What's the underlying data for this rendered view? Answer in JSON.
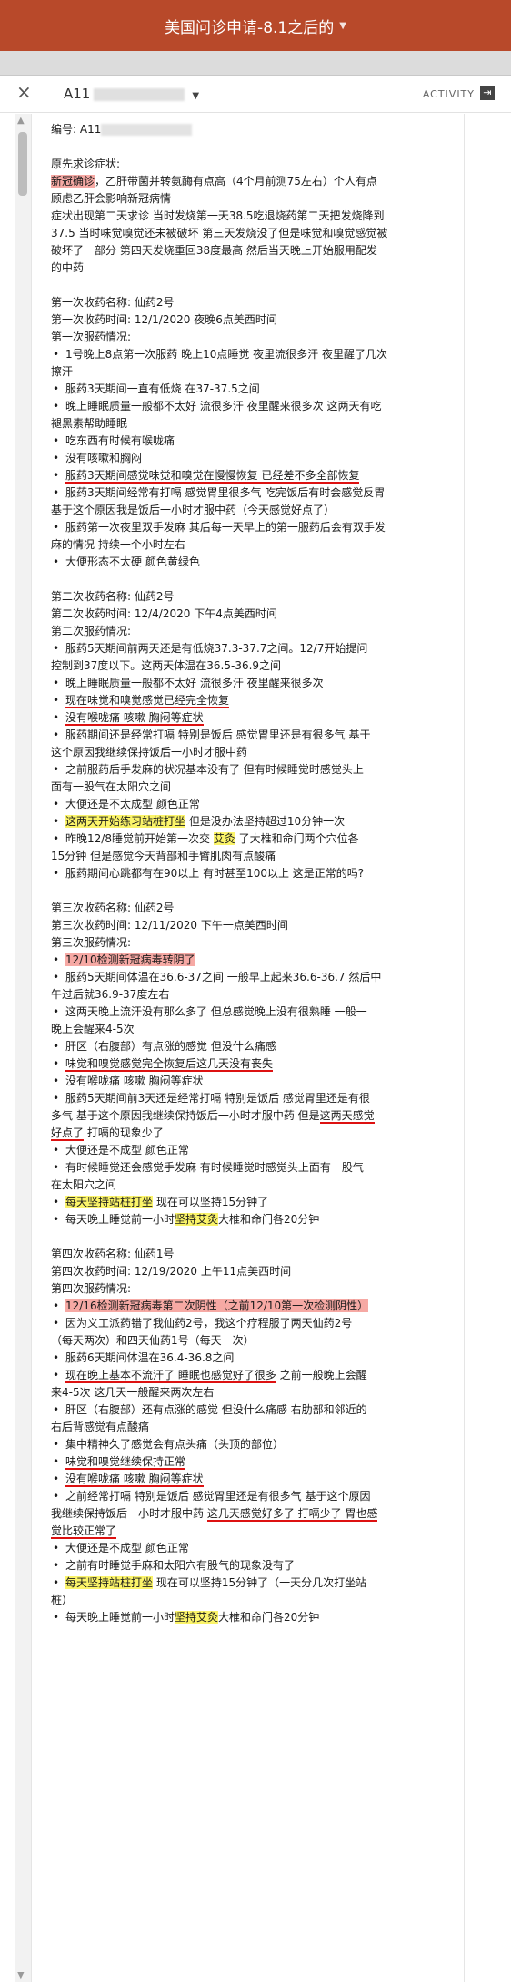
{
  "topbar": {
    "title": "美国问诊申请-8.1之后的"
  },
  "header": {
    "title": "A11",
    "activity": "ACTIVITY"
  },
  "content": {
    "id_label": "编号: A11",
    "sections": [
      {
        "lines": [
          {
            "t": "原先求诊症状:"
          },
          {
            "parts": [
              {
                "t": "新冠确诊",
                "h": "red"
              },
              {
                "t": "，乙肝带菌并转氨酶有点高（4个月前测75左右）个人有点"
              }
            ]
          },
          {
            "t": "顾虑乙肝会影响新冠病情"
          },
          {
            "t": "症状出现第二天求诊 当时发烧第一天38.5吃退烧药第二天把发烧降到"
          },
          {
            "t": "37.5 当时味觉嗅觉还未被破坏 第三天发烧没了但是味觉和嗅觉感觉被"
          },
          {
            "t": "破坏了一部分 第四天发烧重回38度最高 然后当天晚上开始服用配发"
          },
          {
            "t": "的中药"
          }
        ]
      },
      {
        "lines": [
          {
            "t": "第一次收药名称: 仙药2号"
          },
          {
            "t": "第一次收药时间: 12/1/2020 夜晚6点美西时间"
          },
          {
            "t": "第一次服药情况:"
          },
          {
            "b": 1,
            "t": "1号晚上8点第一次服药 晚上10点睡觉 夜里流很多汗 夜里醒了几次"
          },
          {
            "t": "擦汗"
          },
          {
            "b": 1,
            "t": "服药3天期间一直有低烧 在37-37.5之间"
          },
          {
            "b": 1,
            "t": "晚上睡眠质量一般都不太好 流很多汗 夜里醒来很多次 这两天有吃"
          },
          {
            "t": "褪黑素帮助睡眠"
          },
          {
            "b": 1,
            "t": "吃东西有时候有喉咙痛"
          },
          {
            "b": 1,
            "t": "没有咳嗽和胸闷"
          },
          {
            "b": 1,
            "parts": [
              {
                "t": "服药3天期间感觉味觉和嗅觉在慢慢恢复 已经差不多全部恢复",
                "h": "ul"
              }
            ]
          },
          {
            "b": 1,
            "t": "服药3天期间经常有打嗝 感觉胃里很多气 吃完饭后有时会感觉反胃"
          },
          {
            "t": "基于这个原因我是饭后一小时才服中药（今天感觉好点了）"
          },
          {
            "b": 1,
            "t": "服药第一次夜里双手发麻 其后每一天早上的第一服药后会有双手发"
          },
          {
            "t": "麻的情况 持续一个小时左右"
          },
          {
            "b": 1,
            "t": "大便形态不太硬 颜色黄绿色"
          }
        ]
      },
      {
        "lines": [
          {
            "t": "第二次收药名称: 仙药2号"
          },
          {
            "t": "第二次收药时间: 12/4/2020 下午4点美西时间"
          },
          {
            "t": "第二次服药情况:"
          },
          {
            "b": 1,
            "t": "服药5天期间前两天还是有低烧37.3-37.7之间。12/7开始提问"
          },
          {
            "t": "控制到37度以下。这两天体温在36.5-36.9之间"
          },
          {
            "b": 1,
            "t": "晚上睡眠质量一般都不太好 流很多汗 夜里醒来很多次"
          },
          {
            "b": 1,
            "parts": [
              {
                "t": "现在味觉和嗅觉感觉已经完全恢复",
                "h": "ul"
              }
            ]
          },
          {
            "b": 1,
            "parts": [
              {
                "t": "没有喉咙痛 咳嗽 胸闷等症状",
                "h": "ul"
              }
            ]
          },
          {
            "b": 1,
            "t": "服药期间还是经常打嗝 特别是饭后 感觉胃里还是有很多气 基于"
          },
          {
            "t": "这个原因我继续保持饭后一小时才服中药"
          },
          {
            "b": 1,
            "t": "之前服药后手发麻的状况基本没有了 但有时候睡觉时感觉头上"
          },
          {
            "t": "面有一股气在太阳穴之间"
          },
          {
            "b": 1,
            "t": "大便还是不太成型 颜色正常"
          },
          {
            "b": 1,
            "parts": [
              {
                "t": "这两天开始练习站桩打坐",
                "h": "yel"
              },
              {
                "t": " 但是没办法坚持超过10分钟一次"
              }
            ]
          },
          {
            "b": 1,
            "parts": [
              {
                "t": "昨晚12/8睡觉前开始第一次交 "
              },
              {
                "t": "艾灸",
                "h": "yel"
              },
              {
                "t": " 了大椎和命门两个穴位各"
              }
            ]
          },
          {
            "t": "15分钟 但是感觉今天背部和手臂肌肉有点酸痛"
          },
          {
            "b": 1,
            "t": "服药期间心跳都有在90以上 有时甚至100以上 这是正常的吗?"
          }
        ]
      },
      {
        "lines": [
          {
            "t": "第三次收药名称: 仙药2号"
          },
          {
            "t": "第三次收药时间: 12/11/2020 下午一点美西时间"
          },
          {
            "t": "第三次服药情况:"
          },
          {
            "b": 1,
            "parts": [
              {
                "t": "12/10检测新冠病毒转阴了",
                "h": "red"
              }
            ]
          },
          {
            "b": 1,
            "t": "服药5天期间体温在36.6-37之间 一般早上起来36.6-36.7 然后中"
          },
          {
            "t": "午过后就36.9-37度左右"
          },
          {
            "b": 1,
            "t": "这两天晚上流汗没有那么多了 但总感觉晚上没有很熟睡 一般一"
          },
          {
            "t": "晚上会醒来4-5次"
          },
          {
            "b": 1,
            "t": "肝区（右腹部）有点涨的感觉 但没什么痛感"
          },
          {
            "b": 1,
            "parts": [
              {
                "t": "味觉和嗅觉感觉完全恢复后这几天没有丧失",
                "h": "ul"
              }
            ]
          },
          {
            "b": 1,
            "t": "没有喉咙痛 咳嗽 胸闷等症状"
          },
          {
            "b": 1,
            "t": "服药5天期间前3天还是经常打嗝 特别是饭后 感觉胃里还是有很"
          },
          {
            "parts": [
              {
                "t": "多气 基于这个原因我继续保持饭后一小时才服中药 但是"
              },
              {
                "t": "这两天感觉",
                "h": "ul"
              }
            ]
          },
          {
            "parts": [
              {
                "t": "好点了",
                "h": "ul"
              },
              {
                "t": " 打嗝的现象少了"
              }
            ]
          },
          {
            "b": 1,
            "t": "大便还是不成型 颜色正常"
          },
          {
            "b": 1,
            "t": "有时候睡觉还会感觉手发麻 有时候睡觉时感觉头上面有一股气"
          },
          {
            "t": "在太阳穴之间"
          },
          {
            "b": 1,
            "parts": [
              {
                "t": "每天坚持站桩打坐",
                "h": "yel"
              },
              {
                "t": " 现在可以坚持15分钟了"
              }
            ]
          },
          {
            "b": 1,
            "parts": [
              {
                "t": "每天晚上睡觉前一小时"
              },
              {
                "t": "坚持艾灸",
                "h": "yel"
              },
              {
                "t": "大椎和命门各20分钟"
              }
            ]
          }
        ]
      },
      {
        "lines": [
          {
            "t": "第四次收药名称: 仙药1号"
          },
          {
            "t": "第四次收药时间: 12/19/2020 上午11点美西时间"
          },
          {
            "t": "第四次服药情况:"
          },
          {
            "b": 1,
            "parts": [
              {
                "t": "12/16检测新冠病毒第二次阴性（之前12/10第一次检测阴性）",
                "h": "red"
              }
            ]
          },
          {
            "b": 1,
            "t": "因为义工派药错了我仙药2号，我这个疗程服了两天仙药2号"
          },
          {
            "t": "（每天两次）和四天仙药1号（每天一次）"
          },
          {
            "b": 1,
            "t": "服药6天期间体温在36.4-36.8之间"
          },
          {
            "b": 1,
            "parts": [
              {
                "t": "现在晚上基本不流汗了 睡眠也感觉好了很多",
                "h": "ul"
              },
              {
                "t": " 之前一般晚上会醒"
              }
            ]
          },
          {
            "t": "来4-5次 这几天一般醒来两次左右"
          },
          {
            "b": 1,
            "t": "肝区（右腹部）还有点涨的感觉 但没什么痛感 右肋部和邻近的"
          },
          {
            "t": "右后背感觉有点酸痛"
          },
          {
            "b": 1,
            "t": "集中精神久了感觉会有点头痛（头顶的部位）"
          },
          {
            "b": 1,
            "parts": [
              {
                "t": "味觉和嗅觉继续保持正常",
                "h": "ul"
              }
            ]
          },
          {
            "b": 1,
            "parts": [
              {
                "t": "没有喉咙痛 咳嗽 胸闷等症状",
                "h": "ul"
              }
            ]
          },
          {
            "b": 1,
            "t": "之前经常打嗝 特别是饭后 感觉胃里还是有很多气 基于这个原因"
          },
          {
            "parts": [
              {
                "t": "我继续保持饭后一小时才服中药 "
              },
              {
                "t": "这几天感觉好多了 打嗝少了 胃也感",
                "h": "ul"
              }
            ]
          },
          {
            "parts": [
              {
                "t": "觉比较正常了",
                "h": "ul"
              }
            ]
          },
          {
            "b": 1,
            "t": "大便还是不成型 颜色正常"
          },
          {
            "b": 1,
            "t": "之前有时睡觉手麻和太阳穴有股气的现象没有了"
          },
          {
            "b": 1,
            "parts": [
              {
                "t": "每天坚持站桩打坐",
                "h": "yel"
              },
              {
                "t": " 现在可以坚持15分钟了（一天分几次打坐站"
              }
            ]
          },
          {
            "t": "桩）"
          },
          {
            "b": 1,
            "parts": [
              {
                "t": "每天晚上睡觉前一小时"
              },
              {
                "t": "坚持艾灸",
                "h": "yel"
              },
              {
                "t": "大椎和命门各20分钟"
              }
            ]
          }
        ]
      }
    ]
  }
}
